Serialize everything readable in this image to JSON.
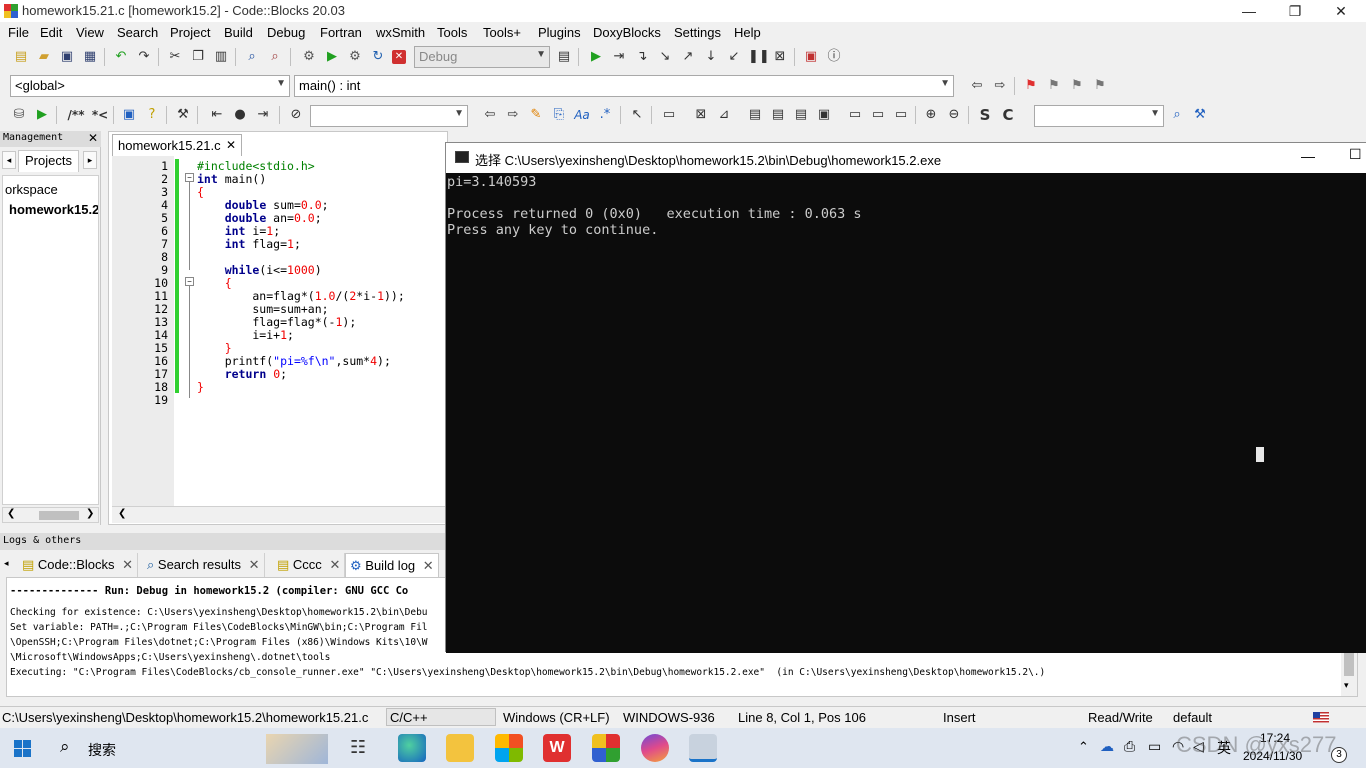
{
  "window": {
    "title": "homework15.21.c [homework15.2] - Code::Blocks 20.03",
    "controls": {
      "minimize": "—",
      "restore": "❐",
      "close": "✕"
    }
  },
  "menu": [
    "File",
    "Edit",
    "View",
    "Search",
    "Project",
    "Build",
    "Debug",
    "Fortran",
    "wxSmith",
    "Tools",
    "Tools+",
    "Plugins",
    "DoxyBlocks",
    "Settings",
    "Help"
  ],
  "toolbar": {
    "build_target": "Debug",
    "scope": "<global>",
    "function": "main() : int",
    "search_value": "",
    "search_value2": ""
  },
  "management": {
    "header": "Management",
    "tab": "Projects",
    "tree": [
      "orkspace",
      "homework15.2"
    ]
  },
  "editor": {
    "tab_label": "homework15.21.c",
    "line_numbers": [
      "1",
      "2",
      "3",
      "4",
      "5",
      "6",
      "7",
      "8",
      "9",
      "10",
      "11",
      "12",
      "13",
      "14",
      "15",
      "16",
      "17",
      "18",
      "19"
    ]
  },
  "logs": {
    "header": "Logs & others",
    "tabs": [
      "Code::Blocks",
      "Search results",
      "Cccc",
      "Build log"
    ],
    "lines": [
      "-------------- Run: Debug in homework15.2 (compiler: GNU GCC Co",
      "Checking for existence: C:\\Users\\yexinsheng\\Desktop\\homework15.2\\bin\\Debu",
      "Set variable: PATH=.;C:\\Program Files\\CodeBlocks\\MinGW\\bin;C:\\Program Fil",
      "\\OpenSSH;C:\\Program Files\\dotnet;C:\\Program Files (x86)\\Windows Kits\\10\\W",
      "\\Microsoft\\WindowsApps;C:\\Users\\yexinsheng\\.dotnet\\tools",
      "Executing: \"C:\\Program Files\\CodeBlocks/cb_console_runner.exe\" \"C:\\Users\\yexinsheng\\Desktop\\homework15.2\\bin\\Debug\\homework15.2.exe\"  (in C:\\Users\\yexinsheng\\Desktop\\homework15.2\\.)"
    ]
  },
  "console": {
    "title": "选择 C:\\Users\\yexinsheng\\Desktop\\homework15.2\\bin\\Debug\\homework15.2.exe",
    "lines": [
      "pi=3.140593",
      "",
      "Process returned 0 (0x0)   execution time : 0.063 s",
      "Press any key to continue."
    ]
  },
  "status": {
    "path": "C:\\Users\\yexinsheng\\Desktop\\homework15.2\\homework15.21.c",
    "language": "C/C++",
    "eol": "Windows (CR+LF)",
    "encoding": "WINDOWS-936",
    "position": "Line 8, Col 1, Pos 106",
    "mode": "Insert",
    "access": "Read/Write",
    "profile": "default"
  },
  "taskbar": {
    "search_label": "搜索",
    "time": "17:24",
    "date": "2024/11/30",
    "ime": "英",
    "notification_count": "3",
    "watermark": "CSDN @yxs277"
  }
}
